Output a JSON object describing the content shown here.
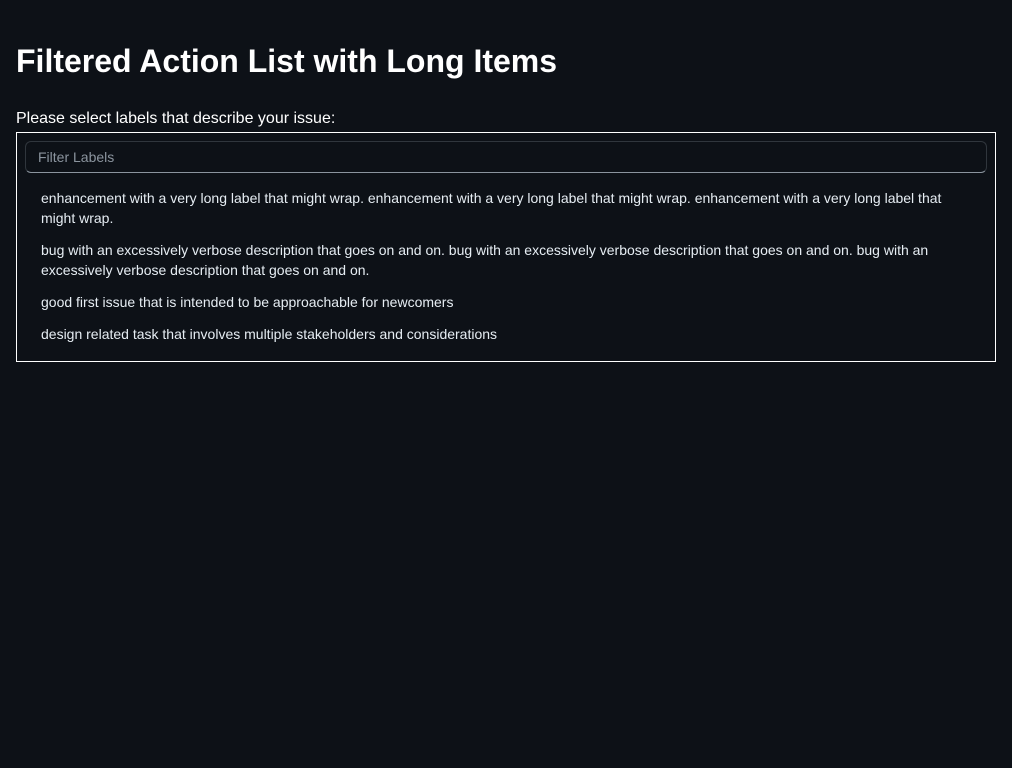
{
  "page": {
    "title": "Filtered Action List with Long Items",
    "prompt": "Please select labels that describe your issue:"
  },
  "filter": {
    "placeholder": "Filter Labels",
    "value": ""
  },
  "items": [
    {
      "label": "enhancement with a very long label that might wrap. enhancement with a very long label that might wrap. enhancement with a very long label that might wrap."
    },
    {
      "label": "bug with an excessively verbose description that goes on and on. bug with an excessively verbose description that goes on and on. bug with an excessively verbose description that goes on and on."
    },
    {
      "label": "good first issue that is intended to be approachable for newcomers"
    },
    {
      "label": "design related task that involves multiple stakeholders and considerations"
    }
  ],
  "colors": {
    "background": "#0d1117",
    "text": "#ffffff",
    "input_border": "#30363d"
  }
}
